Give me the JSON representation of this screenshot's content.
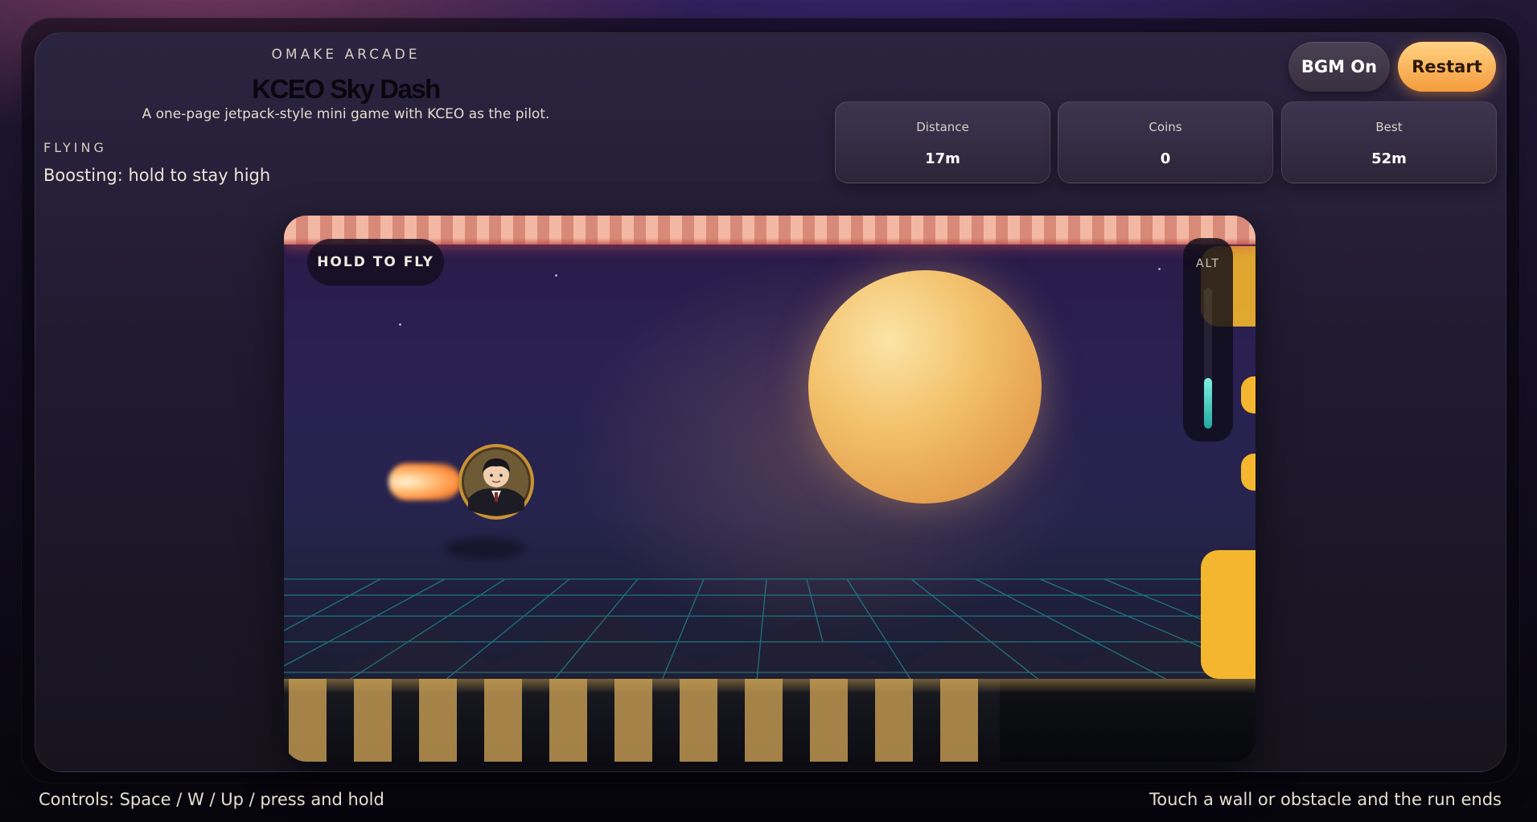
{
  "header": {
    "eyebrow": "OMAKE ARCADE",
    "title": "KCEO Sky Dash",
    "subtitle": "A one-page jetpack-style mini game with KCEO as the pilot."
  },
  "status": {
    "state": "FLYING",
    "message": "Boosting: hold to stay high"
  },
  "buttons": {
    "bgm": "BGM On",
    "restart": "Restart"
  },
  "stats": [
    {
      "label": "Distance",
      "value": "17m"
    },
    {
      "label": "Coins",
      "value": "0"
    },
    {
      "label": "Best",
      "value": "52m"
    }
  ],
  "game": {
    "hint": "HOLD TO FLY",
    "altitude_label": "ALT",
    "altitude_level": 0.36
  },
  "footer": {
    "controls": "Controls: Space / W / Up / press and hold",
    "rules": "Touch a wall or obstacle and the run ends"
  },
  "colors": {
    "accent": "#f59b3c",
    "obstacle": "#f4b62e",
    "altitude": "#2fc2b5"
  }
}
